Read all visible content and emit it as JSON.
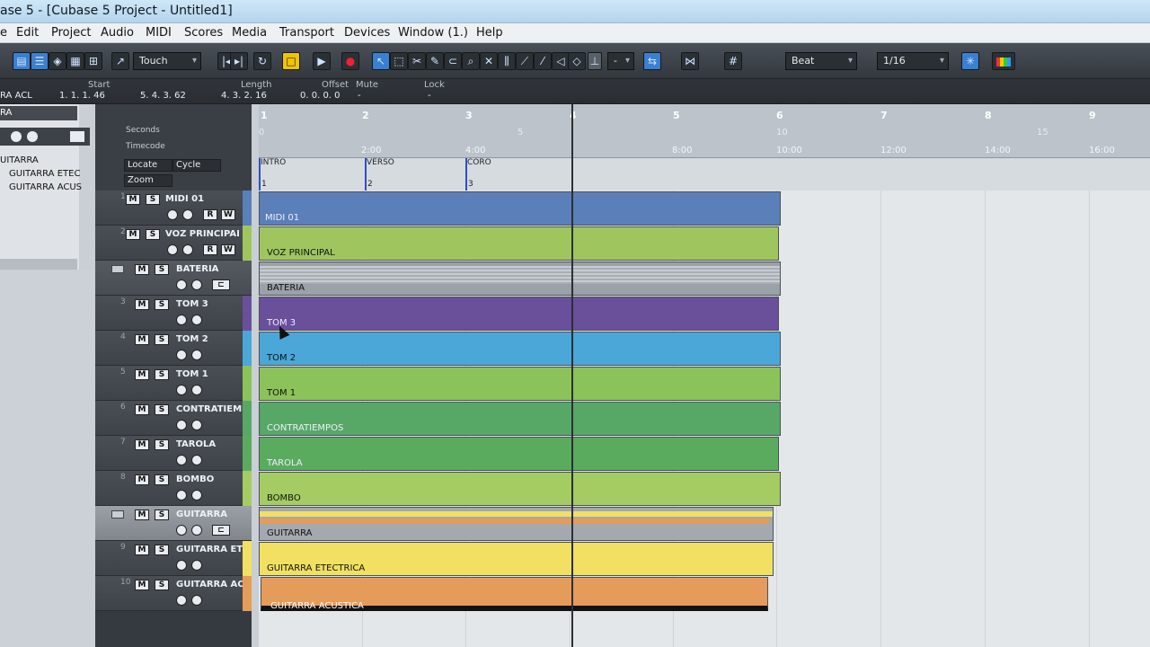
{
  "window": {
    "title": "ase 5 - [Cubase 5 Project - Untitled1]"
  },
  "menu": [
    "e",
    "Edit",
    "Project",
    "Audio",
    "MIDI",
    "Scores",
    "Media",
    "Transport",
    "Devices",
    "Window (1.)",
    "Help"
  ],
  "toolbar": {
    "automation_mode": "Touch",
    "nudge_value": "-",
    "grid_type": "Beat",
    "quantize": "1/16"
  },
  "infoline": {
    "name_value": "RA ACL",
    "start_label": "Start",
    "start_value": "1. 1. 1. 46",
    "end_value": "5. 4. 3. 62",
    "length_label": "Length",
    "length_value": "4. 3. 2. 16",
    "offset_label": "Offset",
    "offset_value": "0. 0. 0. 0",
    "mute_label": "Mute",
    "mute_value": "-",
    "lock_label": "Lock",
    "lock_value": "-"
  },
  "inspector": {
    "header": "RA",
    "items": [
      "UITARRA",
      "GUITARRA ETEC",
      "GUITARRA ACUS"
    ]
  },
  "tracklist_top": {
    "seconds": "Seconds",
    "timecode": "Timecode",
    "locate": "Locate",
    "cycle": "Cycle",
    "zoom": "Zoom"
  },
  "tracks": [
    {
      "num": "1",
      "name": "MIDI 01",
      "type": "midi",
      "color": "#5b7fb8"
    },
    {
      "num": "2",
      "name": "VOZ PRINCIPAL",
      "type": "audio",
      "color": "#9fc65e"
    },
    {
      "num": "",
      "name": "BATERIA",
      "type": "folder",
      "color": "#9aa1a8"
    },
    {
      "num": "3",
      "name": "TOM 3",
      "type": "audio",
      "color": "#6a4f9a"
    },
    {
      "num": "4",
      "name": "TOM 2",
      "type": "audio",
      "color": "#4aa7d8"
    },
    {
      "num": "5",
      "name": "TOM 1",
      "type": "audio",
      "color": "#8cc25a"
    },
    {
      "num": "6",
      "name": "CONTRATIEMP",
      "type": "audio",
      "color": "#57a866"
    },
    {
      "num": "7",
      "name": "TAROLA",
      "type": "audio",
      "color": "#5aab5e"
    },
    {
      "num": "8",
      "name": "BOMBO",
      "type": "audio",
      "color": "#a4cc62"
    },
    {
      "num": "",
      "name": "GUITARRA",
      "type": "folder",
      "color": "#a3a9af"
    },
    {
      "num": "9",
      "name": "GUITARRA ETE",
      "type": "audio",
      "color": "#f1e062"
    },
    {
      "num": "10",
      "name": "GUITARRA ACU",
      "type": "audio",
      "color": "#e59b5a"
    }
  ],
  "parts": [
    "MIDI 01",
    "VOZ PRINCIPAL",
    "BATERIA",
    "TOM 3",
    "TOM 2",
    "TOM 1",
    "CONTRATIEMPOS",
    "TAROLA",
    "BOMBO",
    "GUITARRA",
    "GUITARRA ETECTRICA",
    "GUITARRA ACUSTICA"
  ],
  "ruler": {
    "bars": [
      "1",
      "2",
      "3",
      "4",
      "5",
      "6",
      "7",
      "8",
      "9"
    ],
    "seconds": [
      "0",
      "5",
      "10",
      "15"
    ],
    "timecode": [
      "2:00",
      "4:00",
      "8:00",
      "10:00",
      "12:00",
      "14:00",
      "16:00"
    ]
  },
  "markers": [
    {
      "name": "INTRO",
      "num": "1"
    },
    {
      "name": "VERSO",
      "num": "2"
    },
    {
      "name": "CORO",
      "num": "3"
    }
  ]
}
